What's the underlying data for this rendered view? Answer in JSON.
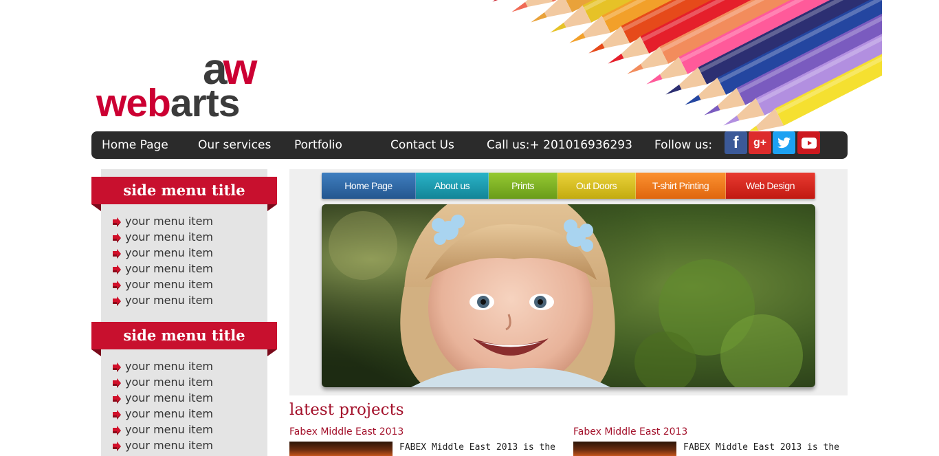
{
  "logo": {
    "a": "a",
    "w": "w",
    "web": "web",
    "arts": "arts"
  },
  "topnav": {
    "items": [
      "Home Page",
      "Our services",
      "Portfolio",
      "Contact Us"
    ],
    "phone": "Call us:+ 201016936293",
    "follow": "Follow us:",
    "social": [
      {
        "name": "facebook",
        "glyph": "f",
        "color": "#3b5998"
      },
      {
        "name": "google-plus",
        "glyph": "g+",
        "color": "#dd2c2c"
      },
      {
        "name": "twitter",
        "glyph": "t",
        "color": "#1da1f2"
      },
      {
        "name": "youtube",
        "glyph": "▶",
        "color": "#cc181e"
      }
    ]
  },
  "sidebar": {
    "sections": [
      {
        "title": "side menu title",
        "items": [
          "your menu item",
          "your menu item",
          "your menu item",
          "your menu item",
          "your menu item",
          "your menu item"
        ]
      },
      {
        "title": "side menu title",
        "items": [
          "your menu item",
          "your menu item",
          "your menu item",
          "your menu item",
          "your menu item",
          "your menu item"
        ]
      }
    ]
  },
  "subnav": {
    "tabs": [
      {
        "label": "Home Page",
        "color": "#2f6aa8"
      },
      {
        "label": "About us",
        "color": "#1a9bb0"
      },
      {
        "label": "Prints",
        "color": "#7fb522"
      },
      {
        "label": "Out Doors",
        "color": "#d9c21a"
      },
      {
        "label": "T-shirt Printing",
        "color": "#f07a1a"
      },
      {
        "label": "Web Design",
        "color": "#d6231e"
      }
    ]
  },
  "latest": {
    "title": "latest projects",
    "projects": [
      {
        "title": "Fabex Middle East 2013",
        "text": "FABEX Middle East 2013 is the"
      },
      {
        "title": "Fabex Middle East 2013",
        "text": "FABEX Middle East 2013 is the"
      }
    ]
  }
}
